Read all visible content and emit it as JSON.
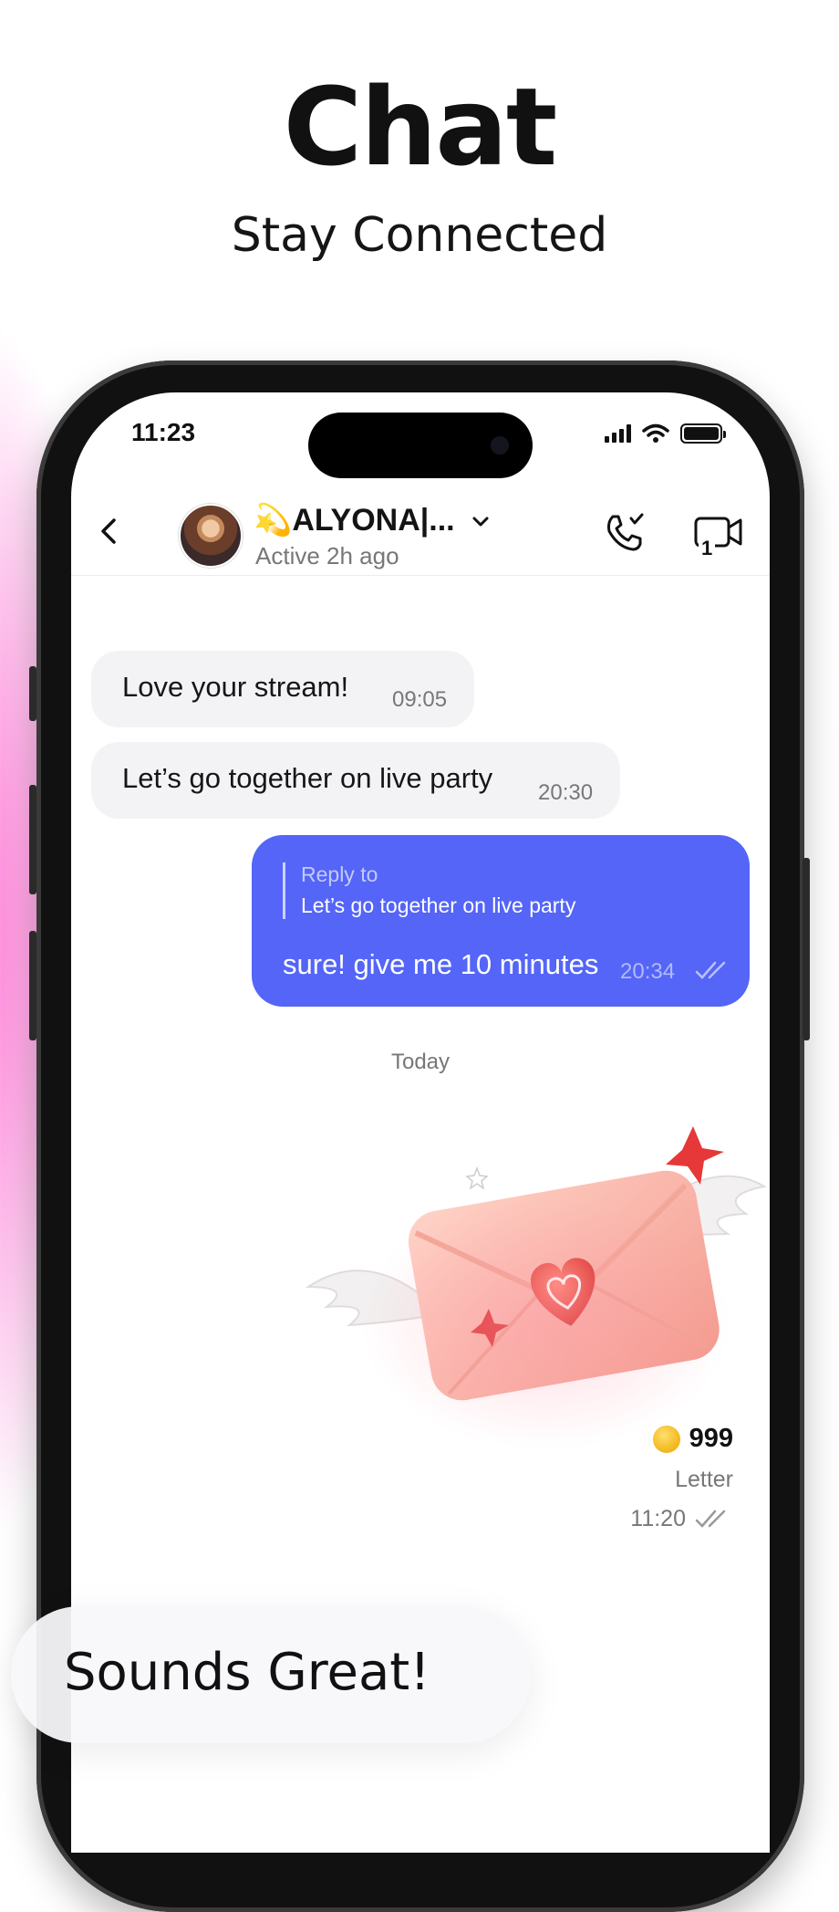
{
  "promo": {
    "headline": "Chat",
    "subheadline": "Stay Connected",
    "caption": "Sounds Great!"
  },
  "status_bar": {
    "time": "11:23"
  },
  "chat_header": {
    "contact_name": "💫ALYONA|...",
    "contact_status": "Active 2h ago",
    "video_call_badge": "1"
  },
  "messages": [
    {
      "direction": "incoming",
      "text": "Love your stream!",
      "time": "09:05"
    },
    {
      "direction": "incoming",
      "text": "Let’s go together on live party",
      "time": "20:30"
    },
    {
      "direction": "outgoing",
      "reply_label": "Reply to",
      "reply_text": "Let’s go together on live party",
      "text": "sure! give me 10 minutes",
      "time": "20:34"
    }
  ],
  "date_separator": "Today",
  "gift_message": {
    "coins": "999",
    "label": "Letter",
    "time": "11:20"
  },
  "colors": {
    "outgoing_bubble": "#5465f7",
    "incoming_bubble": "#f3f3f5",
    "accent_pink": "#ff6ed2",
    "coin": "#f2b51c"
  }
}
